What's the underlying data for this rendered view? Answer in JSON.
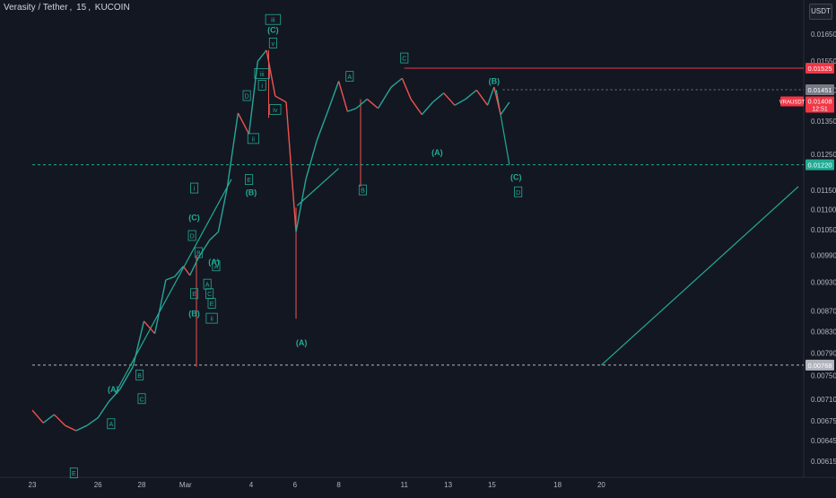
{
  "header": {
    "symbol": "Verasity / Tether",
    "interval": "15",
    "exchange": "KUCOIN"
  },
  "currency_button": "USDT",
  "colors": {
    "background": "#131722",
    "up_candle": "#26a69a",
    "down_candle": "#ef5350",
    "wave_label": "#22ab94",
    "resistance": "#f23645",
    "support": "#22ab94",
    "axis_text": "#b2b5be"
  },
  "chart_data": {
    "type": "candlestick",
    "title": "",
    "ylim": [
      0.00595,
      0.0172
    ],
    "y_scale": "log",
    "y_ticks": [
      "0.01650",
      "0.01550",
      "0.01450",
      "0.01350",
      "0.01250",
      "0.01150",
      "0.01100",
      "0.01050",
      "0.00990",
      "0.00930",
      "0.00870",
      "0.00830",
      "0.00790",
      "0.00750",
      "0.00710",
      "0.00675",
      "0.00645",
      "0.00615"
    ],
    "x_ticks": [
      {
        "label": "23",
        "day": 0
      },
      {
        "label": "26",
        "day": 3
      },
      {
        "label": "28",
        "day": 5
      },
      {
        "label": "Mar",
        "day": 7
      },
      {
        "label": "4",
        "day": 10
      },
      {
        "label": "6",
        "day": 12
      },
      {
        "label": "8",
        "day": 14
      },
      {
        "label": "11",
        "day": 17
      },
      {
        "label": "13",
        "day": 19
      },
      {
        "label": "15",
        "day": 21
      },
      {
        "label": "18",
        "day": 24
      },
      {
        "label": "20",
        "day": 26
      }
    ],
    "price_path": [
      {
        "day": 0.0,
        "price": 0.00692
      },
      {
        "day": 0.5,
        "price": 0.00672
      },
      {
        "day": 1.0,
        "price": 0.00685
      },
      {
        "day": 1.5,
        "price": 0.00668
      },
      {
        "day": 2.0,
        "price": 0.0066
      },
      {
        "day": 2.5,
        "price": 0.00668
      },
      {
        "day": 3.0,
        "price": 0.0068
      },
      {
        "day": 3.5,
        "price": 0.00706
      },
      {
        "day": 4.0,
        "price": 0.00726
      },
      {
        "day": 4.6,
        "price": 0.00765
      },
      {
        "day": 5.1,
        "price": 0.0085
      },
      {
        "day": 5.6,
        "price": 0.00826
      },
      {
        "day": 6.1,
        "price": 0.00935
      },
      {
        "day": 6.5,
        "price": 0.00942
      },
      {
        "day": 6.9,
        "price": 0.00965
      },
      {
        "day": 7.2,
        "price": 0.00945
      },
      {
        "day": 7.6,
        "price": 0.00985
      },
      {
        "day": 8.1,
        "price": 0.01025
      },
      {
        "day": 8.5,
        "price": 0.01045
      },
      {
        "day": 8.9,
        "price": 0.01155
      },
      {
        "day": 9.4,
        "price": 0.01375
      },
      {
        "day": 9.9,
        "price": 0.0131
      },
      {
        "day": 10.3,
        "price": 0.0155
      },
      {
        "day": 10.7,
        "price": 0.0159
      },
      {
        "day": 11.1,
        "price": 0.0143
      },
      {
        "day": 11.6,
        "price": 0.0141
      },
      {
        "day": 12.05,
        "price": 0.01045
      },
      {
        "day": 12.5,
        "price": 0.0118
      },
      {
        "day": 13.0,
        "price": 0.0129
      },
      {
        "day": 13.5,
        "price": 0.0138
      },
      {
        "day": 14.0,
        "price": 0.0148
      },
      {
        "day": 14.4,
        "price": 0.0138
      },
      {
        "day": 14.8,
        "price": 0.0139
      },
      {
        "day": 15.3,
        "price": 0.0142
      },
      {
        "day": 15.8,
        "price": 0.0139
      },
      {
        "day": 16.4,
        "price": 0.0146
      },
      {
        "day": 16.9,
        "price": 0.0149
      },
      {
        "day": 17.3,
        "price": 0.0142
      },
      {
        "day": 17.8,
        "price": 0.0137
      },
      {
        "day": 18.3,
        "price": 0.0141
      },
      {
        "day": 18.8,
        "price": 0.0144
      },
      {
        "day": 19.3,
        "price": 0.014
      },
      {
        "day": 19.8,
        "price": 0.0142
      },
      {
        "day": 20.3,
        "price": 0.0145
      },
      {
        "day": 20.8,
        "price": 0.014
      },
      {
        "day": 21.1,
        "price": 0.0146
      },
      {
        "day": 21.4,
        "price": 0.0137
      },
      {
        "day": 21.8,
        "price": 0.0141
      }
    ],
    "wicks": [
      {
        "day": 12.05,
        "high": 0.01105,
        "low": 0.00855
      },
      {
        "day": 15.0,
        "high": 0.0142,
        "low": 0.0116
      },
      {
        "day": 10.8,
        "high": 0.0159,
        "low": 0.0136
      },
      {
        "day": 7.5,
        "high": 0.0099,
        "low": 0.00765
      }
    ],
    "price_lines": [
      {
        "name": "resistance",
        "price": 0.01525,
        "label": "0.01525",
        "style": "solid",
        "color": "#f23645",
        "from_day": 17.0
      },
      {
        "name": "current",
        "price": 0.01451,
        "label": "0.01451",
        "style": "dotted",
        "color": "#787b86",
        "from_day": 21.5
      },
      {
        "name": "support",
        "price": 0.0122,
        "label": "0.01220",
        "style": "dashed",
        "color": "#22ab94",
        "from_day": 0
      },
      {
        "name": "low-level",
        "price": 0.00768,
        "label": "0.00768",
        "style": "dashed",
        "color": "#b2b5be",
        "from_day": 0
      }
    ],
    "price_tags": [
      {
        "text": "VRAUSDT",
        "price": 0.01408,
        "value": "0.01408",
        "sub": "12:51",
        "color": "#f23645"
      }
    ],
    "trend_lines": [
      {
        "from": {
          "day": 26,
          "price": 0.00768
        },
        "to": {
          "day": 35,
          "price": 0.0116
        }
      },
      {
        "from": {
          "day": 12.1,
          "price": 0.0111
        },
        "to": {
          "day": 14.0,
          "price": 0.0121
        }
      },
      {
        "from": {
          "day": 3.8,
          "price": 0.0072
        },
        "to": {
          "day": 9.1,
          "price": 0.0118
        }
      },
      {
        "from": {
          "day": 21.2,
          "price": 0.0145
        },
        "to": {
          "day": 21.8,
          "price": 0.0122
        }
      }
    ],
    "wave_labels": [
      {
        "text": "iii",
        "boxed": true,
        "day": 11.0,
        "price": 0.01705
      },
      {
        "text": "(C)",
        "boxed": false,
        "day": 11.0,
        "price": 0.01665
      },
      {
        "text": "v",
        "boxed": true,
        "day": 11.0,
        "price": 0.01615
      },
      {
        "text": "iii",
        "boxed": true,
        "day": 10.5,
        "price": 0.01505
      },
      {
        "text": "i",
        "boxed": true,
        "day": 10.5,
        "price": 0.01465
      },
      {
        "text": "D",
        "boxed": true,
        "day": 9.8,
        "price": 0.0143
      },
      {
        "text": "iv",
        "boxed": true,
        "day": 11.1,
        "price": 0.01385
      },
      {
        "text": "ii",
        "boxed": true,
        "day": 10.1,
        "price": 0.01295
      },
      {
        "text": "E",
        "boxed": true,
        "day": 9.9,
        "price": 0.01178
      },
      {
        "text": "(B)",
        "boxed": false,
        "day": 10.0,
        "price": 0.01145
      },
      {
        "text": "i",
        "boxed": true,
        "day": 7.4,
        "price": 0.01155
      },
      {
        "text": "(C)",
        "boxed": false,
        "day": 7.4,
        "price": 0.0108
      },
      {
        "text": "D",
        "boxed": true,
        "day": 7.3,
        "price": 0.01035
      },
      {
        "text": "B",
        "boxed": true,
        "day": 7.6,
        "price": 0.00995
      },
      {
        "text": "(A)",
        "boxed": false,
        "day": 8.3,
        "price": 0.00975
      },
      {
        "text": "A",
        "boxed": true,
        "day": 8.4,
        "price": 0.00965
      },
      {
        "text": "E",
        "boxed": true,
        "day": 7.4,
        "price": 0.00905
      },
      {
        "text": "A",
        "boxed": true,
        "day": 8.0,
        "price": 0.00925
      },
      {
        "text": "C",
        "boxed": true,
        "day": 8.1,
        "price": 0.00905
      },
      {
        "text": "(B)",
        "boxed": false,
        "day": 7.4,
        "price": 0.00865
      },
      {
        "text": "ii",
        "boxed": true,
        "day": 8.2,
        "price": 0.00855
      },
      {
        "text": "E",
        "boxed": true,
        "day": 8.2,
        "price": 0.00885
      },
      {
        "text": "A",
        "boxed": true,
        "day": 14.5,
        "price": 0.01495
      },
      {
        "text": "C",
        "boxed": true,
        "day": 17.0,
        "price": 0.0156
      },
      {
        "text": "(B)",
        "boxed": false,
        "day": 21.1,
        "price": 0.0148
      },
      {
        "text": "(A)",
        "boxed": false,
        "day": 18.5,
        "price": 0.01255
      },
      {
        "text": "B",
        "boxed": true,
        "day": 15.1,
        "price": 0.0115
      },
      {
        "text": "(C)",
        "boxed": false,
        "day": 22.1,
        "price": 0.01185
      },
      {
        "text": "D",
        "boxed": true,
        "day": 22.2,
        "price": 0.01145
      },
      {
        "text": "(A)",
        "boxed": false,
        "day": 12.3,
        "price": 0.00809
      },
      {
        "text": "B",
        "boxed": true,
        "day": 4.9,
        "price": 0.0075
      },
      {
        "text": "(A)",
        "boxed": false,
        "day": 3.7,
        "price": 0.00726
      },
      {
        "text": "C",
        "boxed": true,
        "day": 5.0,
        "price": 0.0071
      },
      {
        "text": "A",
        "boxed": true,
        "day": 3.6,
        "price": 0.0067
      },
      {
        "text": "E",
        "boxed": true,
        "day": 1.9,
        "price": 0.00598
      }
    ]
  }
}
